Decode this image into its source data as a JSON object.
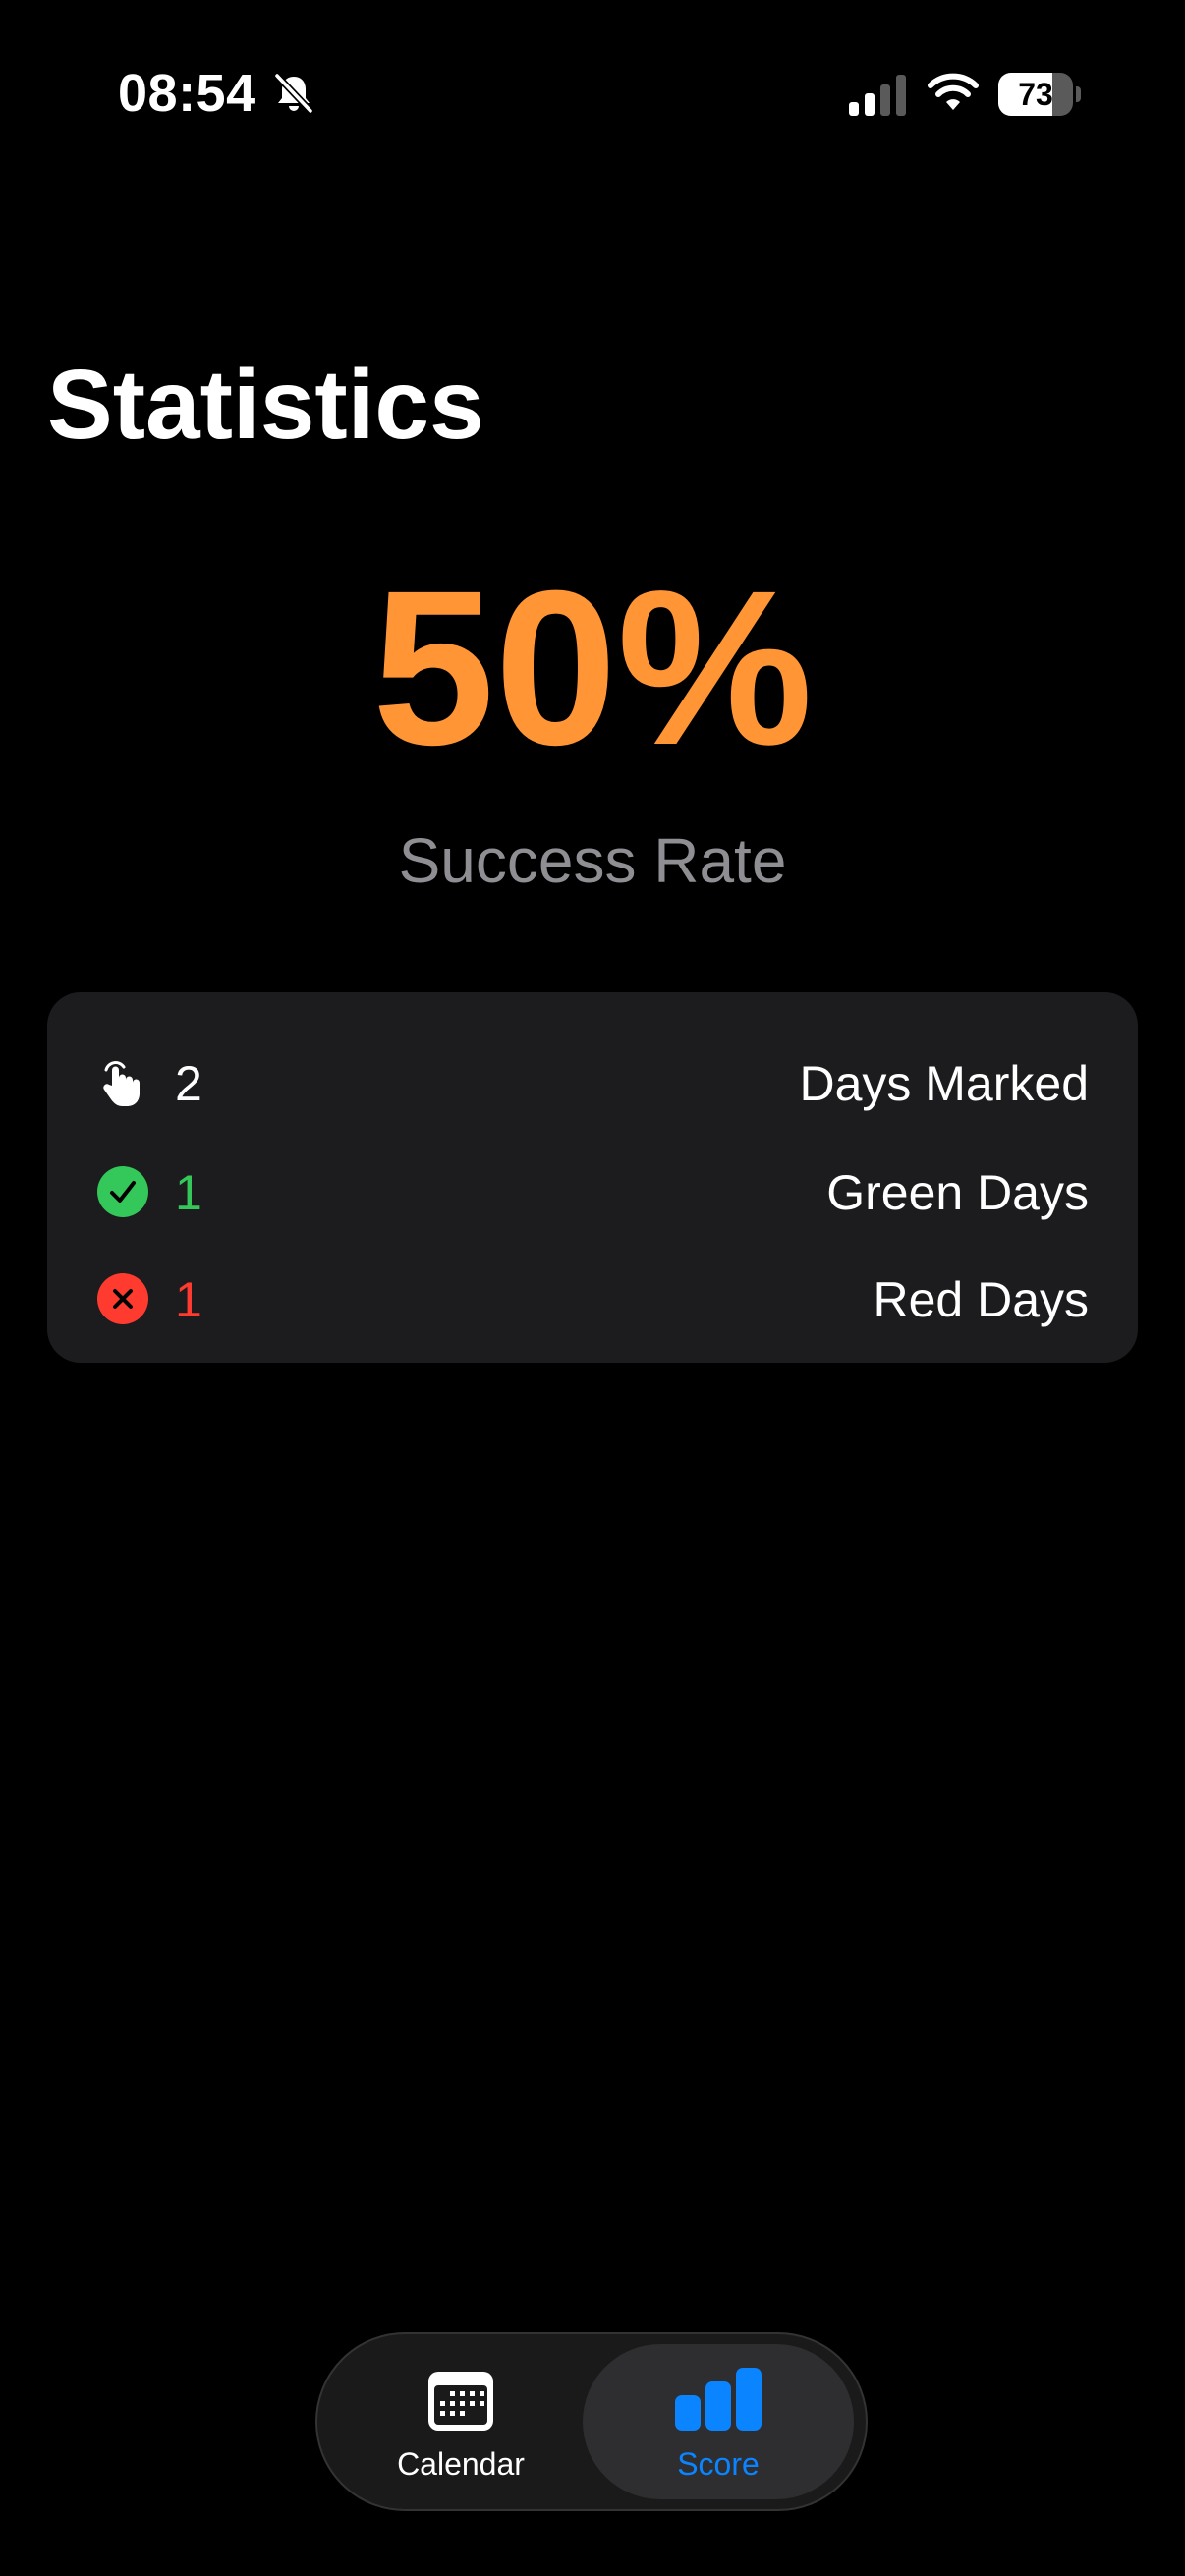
{
  "status_bar": {
    "time": "08:54",
    "battery_percent": "73",
    "battery_level": 0.73,
    "icons": [
      "bell-slash-icon",
      "cellular-signal-icon",
      "wifi-icon",
      "battery-icon"
    ]
  },
  "page": {
    "title": "Statistics"
  },
  "success": {
    "value": "50%",
    "label": "Success Rate",
    "accent_color": "#ff9535"
  },
  "stats": [
    {
      "icon": "hand-tap-icon",
      "value": "2",
      "label": "Days Marked",
      "color": "#ffffff"
    },
    {
      "icon": "checkmark-circle-icon",
      "value": "1",
      "label": "Green Days",
      "color": "#34c759"
    },
    {
      "icon": "xmark-circle-icon",
      "value": "1",
      "label": "Red Days",
      "color": "#ff3b30"
    }
  ],
  "tab_bar": {
    "tabs": [
      {
        "label": "Calendar",
        "icon": "calendar-icon",
        "selected": false
      },
      {
        "label": "Score",
        "icon": "bar-chart-icon",
        "selected": true
      }
    ],
    "selected_color": "#0a84ff"
  }
}
